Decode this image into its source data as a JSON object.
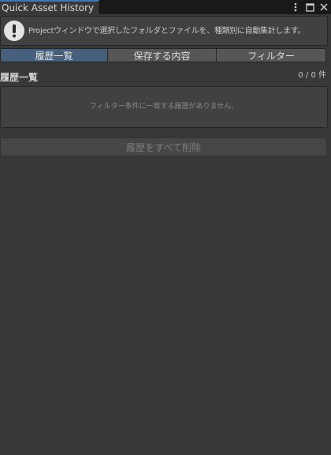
{
  "window": {
    "tab_title": "Quick Asset History",
    "title_icons": [
      "kebab-menu-icon",
      "maximize-icon",
      "close-icon"
    ]
  },
  "help": {
    "icon": "info-icon",
    "text": "Projectウィンドウで選択したフォルダとファイルを、種類別に自動集計します。"
  },
  "toolbar": {
    "tabs": [
      {
        "label": "履歴一覧",
        "active": true
      },
      {
        "label": "保存する内容",
        "active": false
      },
      {
        "label": "フィルター",
        "active": false
      }
    ]
  },
  "history": {
    "title": "履歴一覧",
    "count": "0 / 0 件",
    "empty_message": "フィルター条件に一致する履歴がありません。",
    "clear_label": "履歴をすべて削除",
    "clear_enabled": false
  },
  "colors": {
    "background": "#383838",
    "active_tab": "#46607c",
    "tab_accent": "#3a79bb"
  }
}
